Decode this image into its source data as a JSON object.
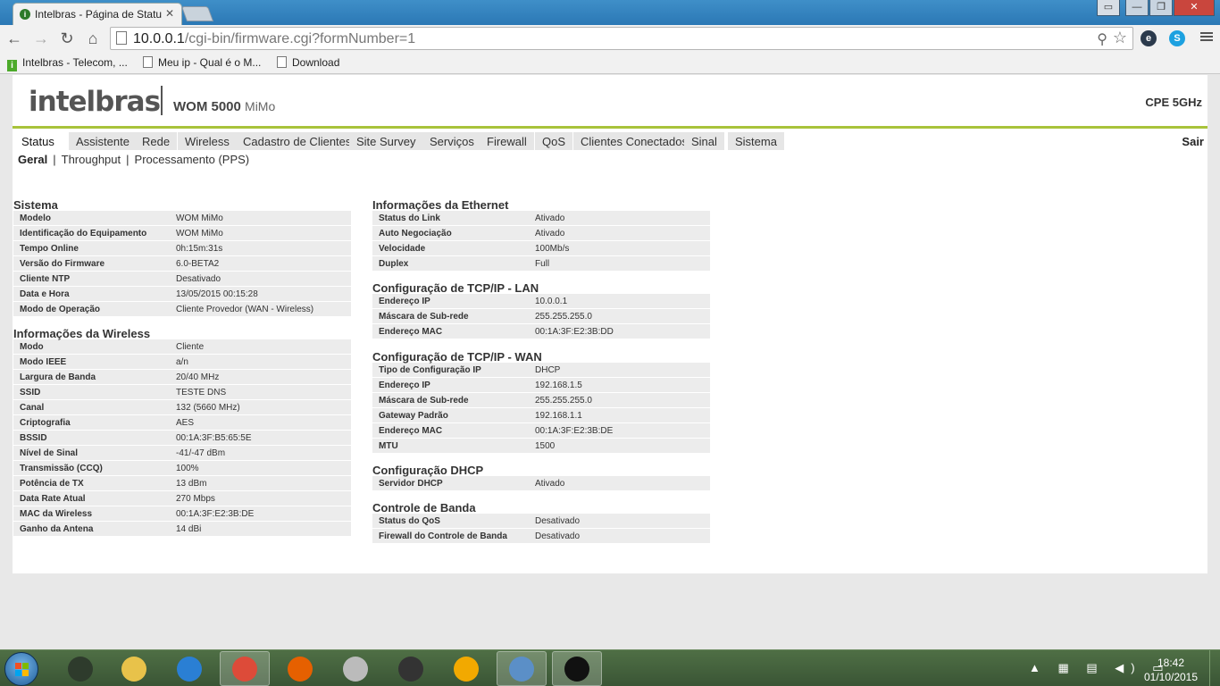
{
  "browser": {
    "tab_title": "Intelbras - Página de Statu",
    "url_host": "10.0.0.1",
    "url_path": "/cgi-bin/firmware.cgi?formNumber=1",
    "bookmarks": [
      {
        "label": "Intelbras - Telecom, ...",
        "icon": "intelbras-favicon"
      },
      {
        "label": "Meu ip - Qual é o M...",
        "icon": "page-icon"
      },
      {
        "label": "Download",
        "icon": "page-icon"
      }
    ]
  },
  "header": {
    "logo": "intelbras",
    "product_name": "WOM 5000",
    "product_suffix": "MiMo",
    "badge": "CPE 5GHz"
  },
  "menu": {
    "items": [
      "Status",
      "Assistente",
      "Rede",
      "Wireless",
      "Cadastro de Clientes",
      "Site Survey",
      "Serviços",
      "Firewall",
      "QoS",
      "Clientes Conectados",
      "Sinal",
      "Sistema"
    ],
    "active": "Status",
    "logout": "Sair"
  },
  "submenu": {
    "items": [
      "Geral",
      "Throughput",
      "Processamento (PPS)"
    ],
    "active": "Geral"
  },
  "sections": {
    "sistema": {
      "title": "Sistema",
      "rows": [
        [
          "Modelo",
          "WOM MiMo"
        ],
        [
          "Identificação do Equipamento",
          "WOM MiMo"
        ],
        [
          "Tempo Online",
          "0h:15m:31s"
        ],
        [
          "Versão do Firmware",
          "6.0-BETA2"
        ],
        [
          "Cliente NTP",
          "Desativado"
        ],
        [
          "Data e Hora",
          "13/05/2015 00:15:28"
        ],
        [
          "Modo de Operação",
          "Cliente Provedor (WAN - Wireless)"
        ]
      ]
    },
    "wireless": {
      "title": "Informações da Wireless",
      "rows": [
        [
          "Modo",
          "Cliente"
        ],
        [
          "Modo IEEE",
          "a/n"
        ],
        [
          "Largura de Banda",
          "20/40 MHz"
        ],
        [
          "SSID",
          "TESTE DNS"
        ],
        [
          "Canal",
          "132 (5660 MHz)"
        ],
        [
          "Criptografia",
          "AES"
        ],
        [
          "BSSID",
          "00:1A:3F:B5:65:5E"
        ],
        [
          "Nível de Sinal",
          "-41/-47 dBm"
        ],
        [
          "Transmissão (CCQ)",
          "100%"
        ],
        [
          "Potência de TX",
          "13 dBm"
        ],
        [
          "Data Rate Atual",
          "270 Mbps"
        ],
        [
          "MAC da Wireless",
          "00:1A:3F:E2:3B:DE"
        ],
        [
          "Ganho da Antena",
          "14 dBi"
        ]
      ]
    },
    "ethernet": {
      "title": "Informações da Ethernet",
      "rows": [
        [
          "Status do Link",
          "Ativado"
        ],
        [
          "Auto Negociação",
          "Ativado"
        ],
        [
          "Velocidade",
          "100Mb/s"
        ],
        [
          "Duplex",
          "Full"
        ]
      ]
    },
    "lan": {
      "title": "Configuração de TCP/IP - LAN",
      "rows": [
        [
          "Endereço IP",
          "10.0.0.1"
        ],
        [
          "Máscara de Sub-rede",
          "255.255.255.0"
        ],
        [
          "Endereço MAC",
          "00:1A:3F:E2:3B:DD"
        ]
      ]
    },
    "wan": {
      "title": "Configuração de TCP/IP - WAN",
      "rows": [
        [
          "Tipo de Configuração IP",
          "DHCP"
        ],
        [
          "Endereço IP",
          "192.168.1.5"
        ],
        [
          "Máscara de Sub-rede",
          "255.255.255.0"
        ],
        [
          "Gateway Padrão",
          "192.168.1.1"
        ],
        [
          "Endereço MAC",
          "00:1A:3F:E2:3B:DE"
        ],
        [
          "MTU",
          "1500"
        ]
      ]
    },
    "dhcp": {
      "title": "Configuração DHCP",
      "rows": [
        [
          "Servidor DHCP",
          "Ativado"
        ]
      ]
    },
    "banda": {
      "title": "Controle de Banda",
      "rows": [
        [
          "Status do QoS",
          "Desativado"
        ],
        [
          "Firewall do Controle de Banda",
          "Desativado"
        ]
      ]
    }
  },
  "taskbar": {
    "apps": [
      "mpc-hc-icon",
      "file-explorer-icon",
      "internet-explorer-icon",
      "chrome-icon",
      "firefox-icon",
      "security-camera-icon",
      "intelbras-camera-icon",
      "audacity-icon",
      "network-config-icon",
      "command-prompt-icon"
    ],
    "time": "18:42",
    "date": "01/10/2015"
  },
  "colors": {
    "accent_green": "#a8c33a",
    "menu_bg": "#e6e6e6",
    "row_bg": "#ececec",
    "taskbar": "#3a5535"
  }
}
